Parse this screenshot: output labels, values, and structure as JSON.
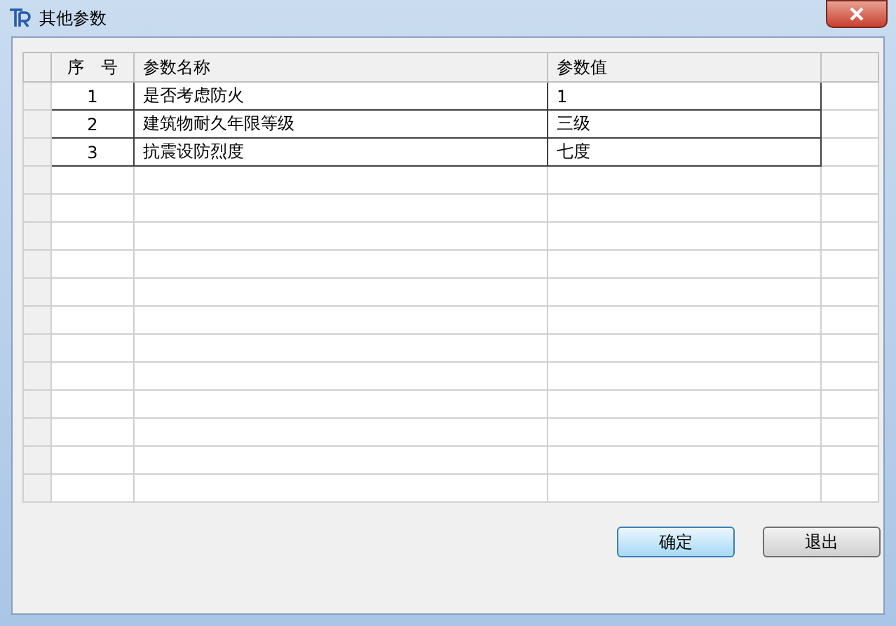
{
  "window": {
    "title": "其他参数"
  },
  "table": {
    "columns": [
      "序　号",
      "参数名称",
      "参数值"
    ],
    "rows": [
      {
        "index": "1",
        "name": "是否考虑防火",
        "value": "1"
      },
      {
        "index": "2",
        "name": "建筑物耐久年限等级",
        "value": "三级"
      },
      {
        "index": "3",
        "name": "抗震设防烈度",
        "value": "七度"
      }
    ]
  },
  "buttons": [
    {
      "label": "确定",
      "focused": true
    },
    {
      "label": "退出",
      "focused": false
    }
  ]
}
